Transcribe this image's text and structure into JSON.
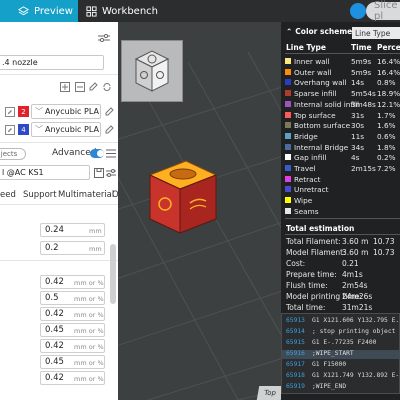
{
  "topbar": {
    "tab_preview": "Preview",
    "tab_workbench": "Workbench",
    "slice_button": "Slice pl",
    "accent": "#14a0c8"
  },
  "left": {
    "nozzle": ".4 nozzle",
    "filaments": [
      {
        "num": "2",
        "name": "Anycubic PLA",
        "color": "#e0232b"
      },
      {
        "num": "4",
        "name": "Anycubic PLA",
        "color": "#2d49c8"
      }
    ],
    "objects_chip": "jects",
    "advanced_label": "Advanced",
    "profile": "l @AC KS1",
    "tabs": [
      "eed",
      "Support",
      "Multimaterial",
      "O"
    ],
    "values": [
      {
        "value": "0.24",
        "unit": "mm"
      },
      {
        "value": "0.2",
        "unit": "mm"
      },
      {
        "value": "0.42",
        "unit": "mm or %"
      },
      {
        "value": "0.5",
        "unit": "mm or %"
      },
      {
        "value": "0.42",
        "unit": "mm or %"
      },
      {
        "value": "0.45",
        "unit": "mm or %"
      },
      {
        "value": "0.42",
        "unit": "mm or %"
      },
      {
        "value": "0.45",
        "unit": "mm or %"
      },
      {
        "value": "0.42",
        "unit": "mm or %"
      }
    ]
  },
  "scheme": {
    "title": "Color scheme",
    "mode": "Line Type",
    "col_line_type": "Line Type",
    "col_time": "Time",
    "col_percent": "Percen",
    "rows": [
      {
        "name": "Inner wall",
        "time": "5m9s",
        "pct": "16.4%",
        "color": "#ffe680"
      },
      {
        "name": "Outer wall",
        "time": "5m9s",
        "pct": "16.4%",
        "color": "#ff8c00"
      },
      {
        "name": "Overhang wall",
        "time": "14s",
        "pct": "0.8%",
        "color": "#2a3cbf"
      },
      {
        "name": "Sparse infill",
        "time": "5m54s",
        "pct": "18.9%",
        "color": "#b03a2e"
      },
      {
        "name": "Internal solid infill",
        "time": "3m48s",
        "pct": "12.1%",
        "color": "#a052c0"
      },
      {
        "name": "Top surface",
        "time": "31s",
        "pct": "1.7%",
        "color": "#ff5a5a"
      },
      {
        "name": "Bottom surface",
        "time": "30s",
        "pct": "1.6%",
        "color": "#7a7a5a"
      },
      {
        "name": "Bridge",
        "time": "11s",
        "pct": "0.6%",
        "color": "#5aa0c8"
      },
      {
        "name": "Internal Bridge",
        "time": "34s",
        "pct": "1.8%",
        "color": "#4a6aa0"
      },
      {
        "name": "Gap infill",
        "time": "4s",
        "pct": "0.2%",
        "color": "#ffffff"
      },
      {
        "name": "Travel",
        "time": "2m15s",
        "pct": "7.2%",
        "color": "#3a5ac8"
      },
      {
        "name": "Retract",
        "time": "",
        "pct": "",
        "color": "#e040e0"
      },
      {
        "name": "Unretract",
        "time": "",
        "pct": "",
        "color": "#4a4ad0"
      },
      {
        "name": "Wipe",
        "time": "",
        "pct": "",
        "color": "#ffff00"
      },
      {
        "name": "Seams",
        "time": "",
        "pct": "",
        "color": "#e6e6e6"
      }
    ],
    "est_title": "Total estimation",
    "estimates": [
      {
        "k": "Total Filament:",
        "v": "3.60 m",
        "v2": "10.73"
      },
      {
        "k": "Model Filament:",
        "v": "3.60 m",
        "v2": "10.73"
      },
      {
        "k": "Cost:",
        "v": "0.21",
        "v2": ""
      },
      {
        "k": "Prepare time:",
        "v": "4m1s",
        "v2": ""
      },
      {
        "k": "Flush time:",
        "v": "2m54s",
        "v2": ""
      },
      {
        "k": "Model printing time:",
        "v": "24m26s",
        "v2": ""
      },
      {
        "k": "Total time:",
        "v": "31m21s",
        "v2": ""
      }
    ]
  },
  "gcode": [
    {
      "ln": "65913",
      "code": "G1 X121.606 Y132.795 E.007"
    },
    {
      "ln": "65914",
      "code": "; stop printing object Voron_"
    },
    {
      "ln": "65915",
      "code": "G1 E-.77235 F2400"
    },
    {
      "ln": "65916",
      "code": ";WIPE_START"
    },
    {
      "ln": "65917",
      "code": "G1 F15000"
    },
    {
      "ln": "65918",
      "code": "G1 X121.749 Y132.892 E-.02"
    },
    {
      "ln": "65919",
      "code": ";WIPE_END"
    }
  ],
  "viewport": {
    "top_label": "Top"
  }
}
